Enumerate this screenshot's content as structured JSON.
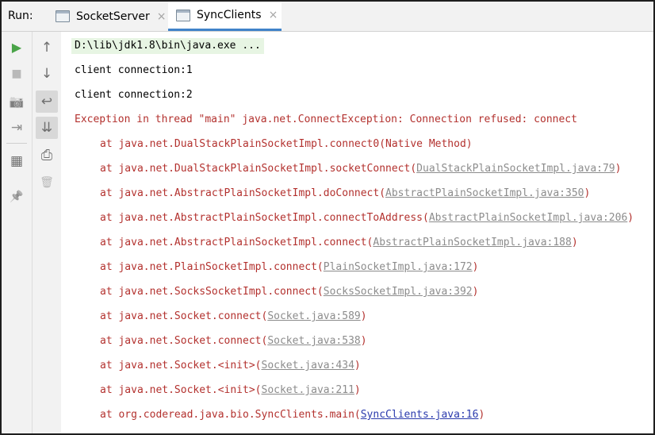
{
  "run_label": "Run:",
  "tabs": [
    {
      "label": "SocketServer",
      "close": "×"
    },
    {
      "label": "SyncClients",
      "close": "×"
    }
  ],
  "toolbar": {
    "run_icon": "▶",
    "stop_icon": "■",
    "camera_icon": "📷",
    "login_icon": "⇥",
    "layout_icon": "▦",
    "pin_icon": "📌",
    "up_icon": "↑",
    "down_icon": "↓",
    "wrap_icon": "↩",
    "scroll_end_icon": "⇊",
    "print_icon": "⎙",
    "trash_icon": "🗑"
  },
  "console": {
    "command": "D:\\lib\\jdk1.8\\bin\\java.exe ...",
    "out1": "client connection:1",
    "out2": "client connection:2",
    "exception": "Exception in thread \"main\" java.net.ConnectException: Connection refused: connect",
    "stack": [
      {
        "prefix": "at java.net.DualStackPlainSocketImpl.connect0(Native Method)",
        "link": "",
        "suffix": ""
      },
      {
        "prefix": "at java.net.DualStackPlainSocketImpl.socketConnect(",
        "link": "DualStackPlainSocketImpl.java:79",
        "suffix": ")"
      },
      {
        "prefix": "at java.net.AbstractPlainSocketImpl.doConnect(",
        "link": "AbstractPlainSocketImpl.java:350",
        "suffix": ")"
      },
      {
        "prefix": "at java.net.AbstractPlainSocketImpl.connectToAddress(",
        "link": "AbstractPlainSocketImpl.java:206",
        "suffix": ")"
      },
      {
        "prefix": "at java.net.AbstractPlainSocketImpl.connect(",
        "link": "AbstractPlainSocketImpl.java:188",
        "suffix": ")"
      },
      {
        "prefix": "at java.net.PlainSocketImpl.connect(",
        "link": "PlainSocketImpl.java:172",
        "suffix": ")"
      },
      {
        "prefix": "at java.net.SocksSocketImpl.connect(",
        "link": "SocksSocketImpl.java:392",
        "suffix": ")"
      },
      {
        "prefix": "at java.net.Socket.connect(",
        "link": "Socket.java:589",
        "suffix": ")"
      },
      {
        "prefix": "at java.net.Socket.connect(",
        "link": "Socket.java:538",
        "suffix": ")"
      },
      {
        "prefix": "at java.net.Socket.<init>(",
        "link": "Socket.java:434",
        "suffix": ")"
      },
      {
        "prefix": "at java.net.Socket.<init>(",
        "link": "Socket.java:211",
        "suffix": ")"
      },
      {
        "prefix": "at org.coderead.java.bio.SyncClients.main(",
        "link": "SyncClients.java:16",
        "suffix": ")"
      }
    ]
  },
  "colors": {
    "error_text": "#b3312e",
    "link_gray": "#8c8c8c",
    "link_blue": "#2a3aad",
    "command_bg": "#e7f5e3",
    "tab_underline": "#4083c9"
  }
}
